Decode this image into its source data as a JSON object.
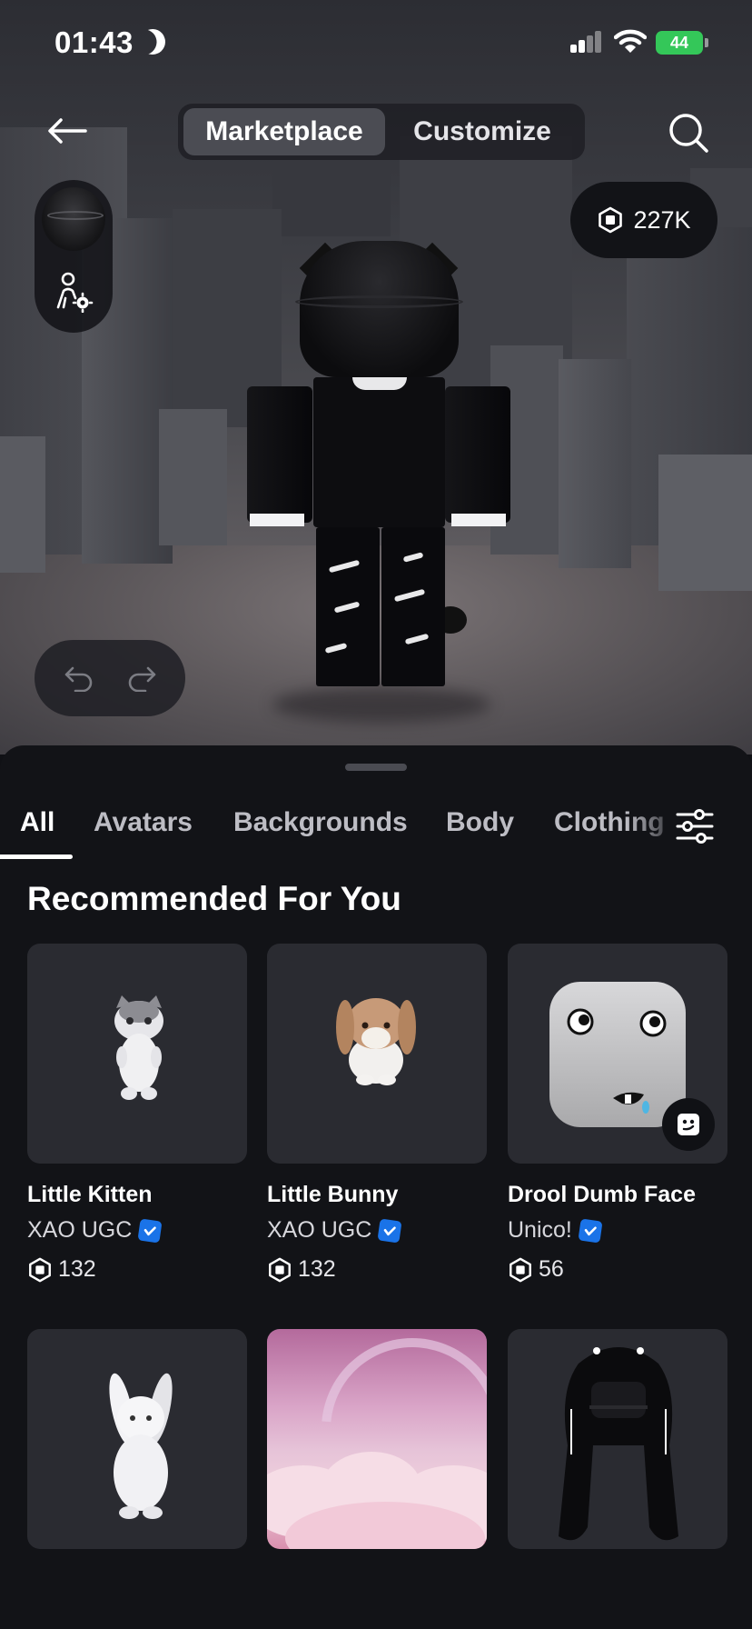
{
  "status_bar": {
    "time": "01:43",
    "battery": "44"
  },
  "top_nav": {
    "tabs": [
      {
        "label": "Marketplace",
        "active": true
      },
      {
        "label": "Customize",
        "active": false
      }
    ]
  },
  "robux_balance": "227K",
  "categories": [
    {
      "label": "All",
      "active": true
    },
    {
      "label": "Avatars",
      "active": false
    },
    {
      "label": "Backgrounds",
      "active": false
    },
    {
      "label": "Body",
      "active": false
    },
    {
      "label": "Clothing",
      "active": false
    }
  ],
  "section": {
    "title": "Recommended For You"
  },
  "items": [
    {
      "name": "Little Kitten",
      "creator": "XAO UGC",
      "verified": true,
      "price": "132"
    },
    {
      "name": "Little Bunny",
      "creator": "XAO UGC",
      "verified": true,
      "price": "132"
    },
    {
      "name": "Drool Dumb Face",
      "creator": "Unico!",
      "verified": true,
      "price": "56"
    }
  ],
  "colors": {
    "sheet_bg": "#121317",
    "card_bg": "#2a2b31",
    "verified": "#1a73e8",
    "battery": "#34c759"
  },
  "icons": [
    "moon-icon",
    "signal-icon",
    "wifi-icon",
    "battery-icon",
    "back-arrow-icon",
    "search-icon",
    "avatar-settings-icon",
    "robux-icon",
    "undo-icon",
    "redo-icon",
    "filter-icon",
    "verified-icon",
    "face-icon"
  ]
}
